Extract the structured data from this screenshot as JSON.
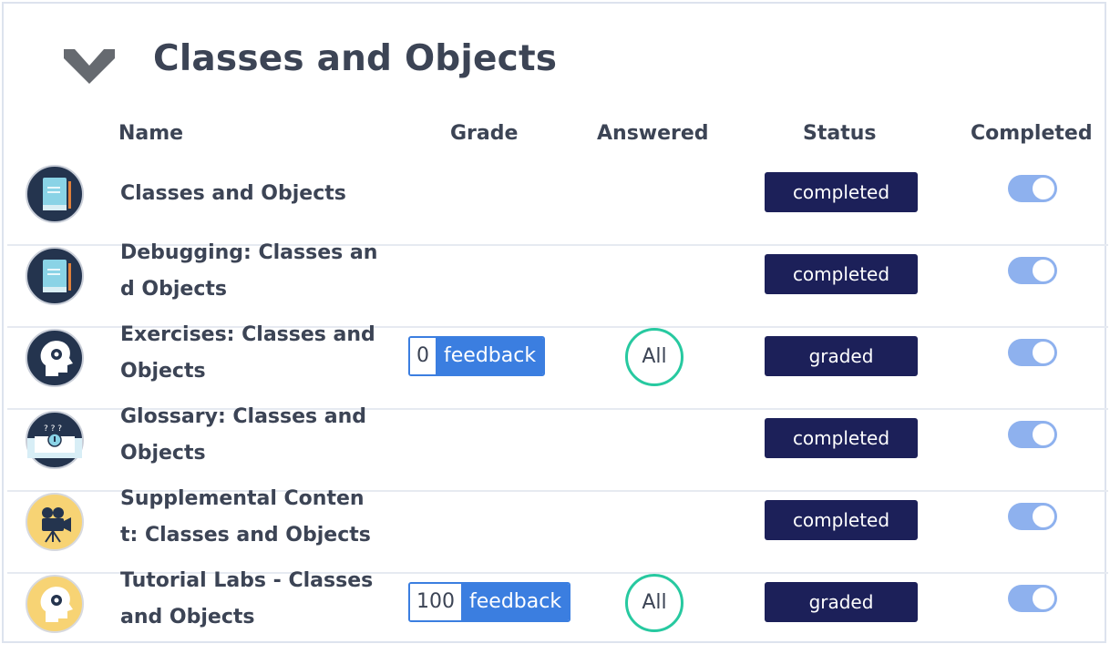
{
  "section": {
    "title": "Classes and Objects",
    "icon": "chevron-down-icon"
  },
  "columns": {
    "name": "Name",
    "grade": "Grade",
    "answered": "Answered",
    "status": "Status",
    "completed": "Completed"
  },
  "colors": {
    "status_bg": "#1c2059",
    "feedback_bg": "#3b7ee0",
    "answered_ring": "#27c9a0",
    "toggle_on": "#8eb1ee"
  },
  "rows": [
    {
      "icon": "book-icon",
      "name": "Classes and Objects",
      "status": "completed",
      "completed": true
    },
    {
      "icon": "book-icon",
      "name": "Debugging: Classes and Objects",
      "status": "completed",
      "completed": true
    },
    {
      "icon": "head-gear-icon",
      "name": "Exercises: Classes and Objects",
      "grade": "0",
      "feedback": "feedback",
      "answered": "All",
      "status": "graded",
      "completed": true
    },
    {
      "icon": "glossary-book-icon",
      "name": "Glossary: Classes and Objects",
      "status": "completed",
      "completed": true
    },
    {
      "icon": "film-camera-icon",
      "name": "Supplemental Content: Classes and Objects",
      "status": "completed",
      "completed": true
    },
    {
      "icon": "head-gear-icon",
      "name": "Tutorial Labs - Classes and Objects",
      "grade": "100",
      "feedback": "feedback",
      "answered": "All",
      "status": "graded",
      "completed": true
    }
  ]
}
